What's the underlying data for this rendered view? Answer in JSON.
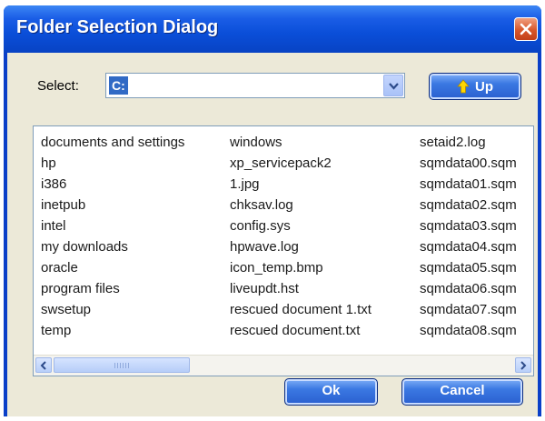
{
  "window": {
    "title": "Folder Selection Dialog"
  },
  "select": {
    "label": "Select:",
    "value": "C:"
  },
  "toolbar": {
    "up_label": "Up"
  },
  "list": {
    "columns": [
      [
        "documents and settings",
        "hp",
        "i386",
        "inetpub",
        "intel",
        "my downloads",
        "oracle",
        "program files",
        "swsetup",
        "temp"
      ],
      [
        "windows",
        "xp_servicepack2",
        "1.jpg",
        "chksav.log",
        "config.sys",
        "hpwave.log",
        "icon_temp.bmp",
        "liveupdt.hst",
        "rescued document 1.txt",
        "rescued document.txt"
      ],
      [
        "setaid2.log",
        "sqmdata00.sqm",
        "sqmdata01.sqm",
        "sqmdata02.sqm",
        "sqmdata03.sqm",
        "sqmdata04.sqm",
        "sqmdata05.sqm",
        "sqmdata06.sqm",
        "sqmdata07.sqm",
        "sqmdata08.sqm"
      ]
    ]
  },
  "buttons": {
    "ok": "Ok",
    "cancel": "Cancel"
  },
  "icons": {
    "close": "close-icon",
    "dropdown": "chevron-down-icon",
    "up": "up-arrow-icon",
    "scroll_left": "scroll-left-icon",
    "scroll_right": "scroll-right-icon"
  },
  "colors": {
    "titlebar": "#0a4ed8",
    "dialog_face": "#ece9d8",
    "selection": "#316ac5",
    "up_arrow": "#ffd700",
    "close_button": "#d8562a"
  }
}
